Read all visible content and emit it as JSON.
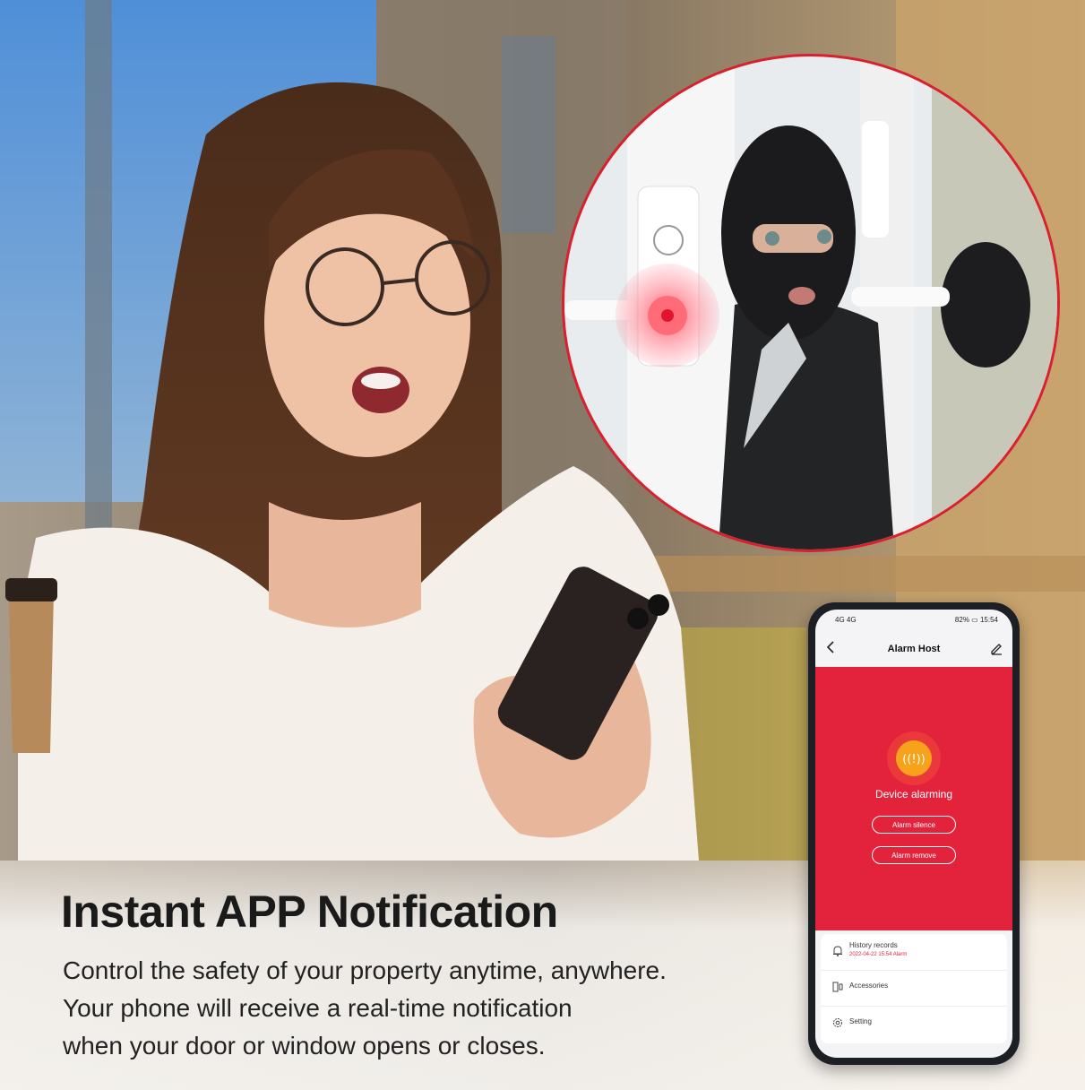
{
  "headline": "Instant APP Notification",
  "description_lines": [
    "Control the safety of your property anytime, anywhere.",
    "Your phone will receive a real-time notification",
    "when your door or window opens or closes."
  ],
  "phone": {
    "status_bar": {
      "left": "4G 4G",
      "battery": "82%",
      "time": "15:54"
    },
    "header": {
      "title": "Alarm Host",
      "back_icon": "chevron-left-icon",
      "edit_icon": "pencil-icon"
    },
    "alarm": {
      "icon": "alarm-siren-icon",
      "status_text": "Device alarming",
      "silence_label": "Alarm silence",
      "remove_label": "Alarm remove",
      "panel_color": "#e3233b",
      "icon_color": "#f7a21b"
    },
    "menu": [
      {
        "icon": "bell-icon",
        "label": "History records",
        "sub": "2022-04-22 15:54 Alarm"
      },
      {
        "icon": "devices-icon",
        "label": "Accessories"
      },
      {
        "icon": "gear-icon",
        "label": "Setting"
      }
    ]
  },
  "accent_color": "#d8202e"
}
